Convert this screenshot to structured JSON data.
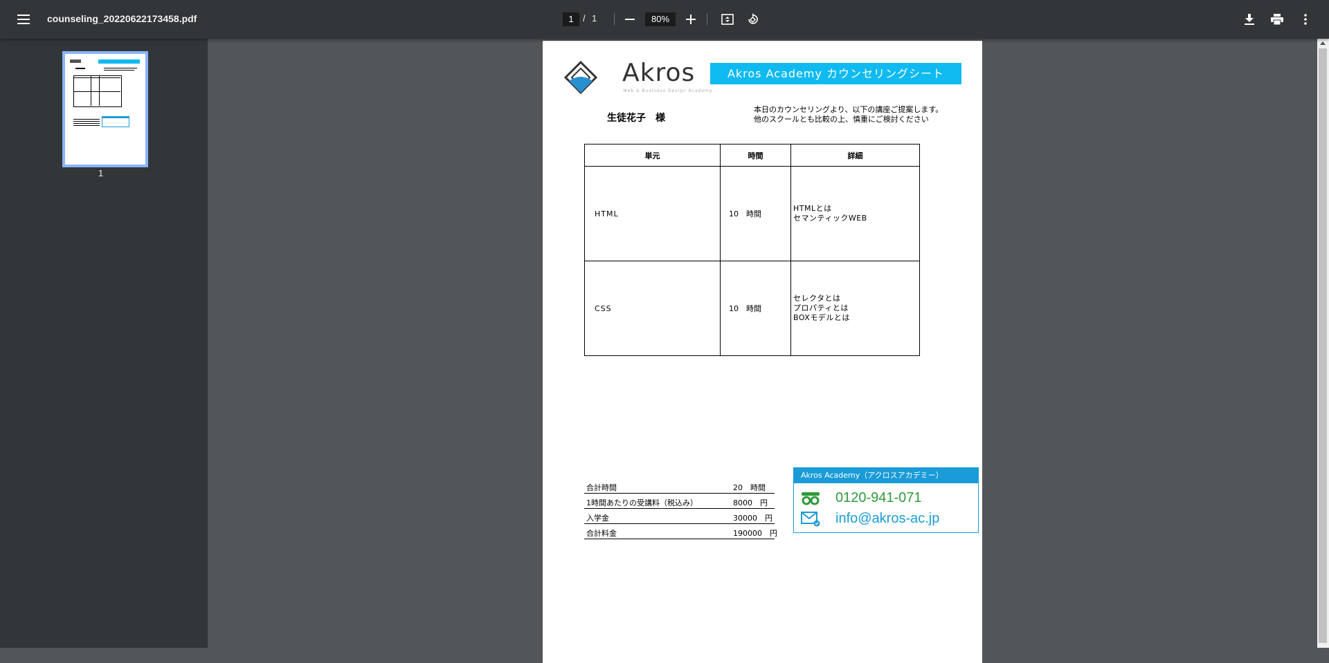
{
  "toolbar": {
    "file_name": "counseling_20220622173458.pdf",
    "current_page": "1",
    "page_separator": "/",
    "total_pages": "1",
    "zoom": "80%"
  },
  "sidebar": {
    "thumbnail_label": "1"
  },
  "document": {
    "logo_text": "Akros",
    "logo_subtitle": "Web & Business Design Academy",
    "header_title": "Akros Academy カウンセリングシート",
    "student_name": "生徒花子　様",
    "proposal_line1": "本日のカウンセリングより、以下の講座ご提案します。",
    "proposal_line2": "他のスクールとも比較の上、慎重にご検討ください",
    "table": {
      "headers": [
        "単元",
        "時間",
        "詳細"
      ],
      "rows": [
        {
          "unit": "HTML",
          "time": "10　時間",
          "details": [
            "HTMLとは",
            "セマンティックWEB"
          ]
        },
        {
          "unit": "CSS",
          "time": "10　時間",
          "details": [
            "セレクタとは",
            "プロパティとは",
            "BOXモデルとは"
          ]
        }
      ]
    },
    "summary": [
      {
        "label": "合計時間",
        "value": "20　時間"
      },
      {
        "label": "1時間あたりの受講料（税込み）",
        "value": "8000　円"
      },
      {
        "label": "入学金",
        "value": "30000　円"
      },
      {
        "label": "合計料金",
        "value": "190000　円"
      }
    ],
    "contact": {
      "title": "Akros Academy（アクロスアカデミー）",
      "phone": "0120-941-071",
      "email": "info@akros-ac.jp"
    }
  },
  "colors": {
    "toolbar_bg": "#323639",
    "viewer_bg": "#525659",
    "banner": "#0fbaf0",
    "contact_blue": "#1a9bd7",
    "phone_green": "#2e9a3a",
    "thumb_border": "#8ab4f8"
  }
}
